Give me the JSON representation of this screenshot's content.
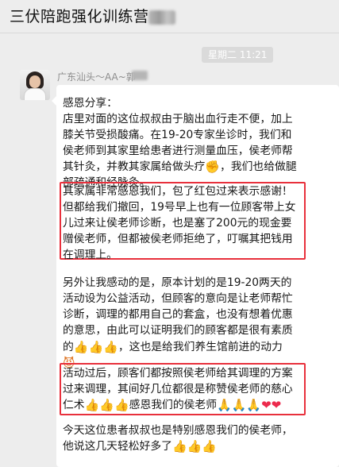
{
  "header": {
    "title": "三伏陪跑强化训练营"
  },
  "time_badge": "星期二 11:21",
  "sender": {
    "name": "广东汕头～AA~郭"
  },
  "message": {
    "lines": {
      "l1": "感恩分享：",
      "l2": "店里对面的这位叔叔由于脑出血行走不便，加上",
      "l3": "膝关节受损酸痛。在19-20专家坐诊时，我们和",
      "l4": "侯老师到其家里给患者进行测量血压，侯老师帮",
      "l5a": "其针灸，并教其家属给做头疗",
      "l5b": "，我们也给做腿",
      "l6": "部疏通和经脉灸。",
      "l7": "其家属非常感恩我们，包了红包过来表示感谢！",
      "l8": "但都给我们撤回，19号早上也有一位顾客带上女",
      "l9": "儿过来让侯老师诊断，也是塞了200元的现金要",
      "l10": "赠侯老师，但都被侯老师拒绝了，叮嘱其把钱用",
      "l11": "在调理上。",
      "l12": "另外让我感动的是，原本计划的是19-20两天的",
      "l13": "活动设为公益活动，但顾客的意向是让老师帮忙",
      "l14": "诊断，调理的都用自己的套盒，也没有想着优惠",
      "l15": "的意思，由此可以证明我们的顾客都是很有素质",
      "l16": "的",
      "l17": "，这也是给我们养生馆前进的动力",
      "l19": "活动过后，顾客们都按照侯老师给其调理的方案",
      "l20": "过来调理，其间好几位都很是称赞侯老师的慈心",
      "l21a": "仁术",
      "l21b": "感恩我们的侯老师",
      "l22": "今天这位患者叔叔也是特别感恩我们的侯老师，",
      "l23": "他说这几天轻松好多了"
    },
    "emoji": {
      "thumb": "👍",
      "heart": "❤",
      "pray": "🙏",
      "fist": "✊",
      "devil": "😈"
    }
  }
}
